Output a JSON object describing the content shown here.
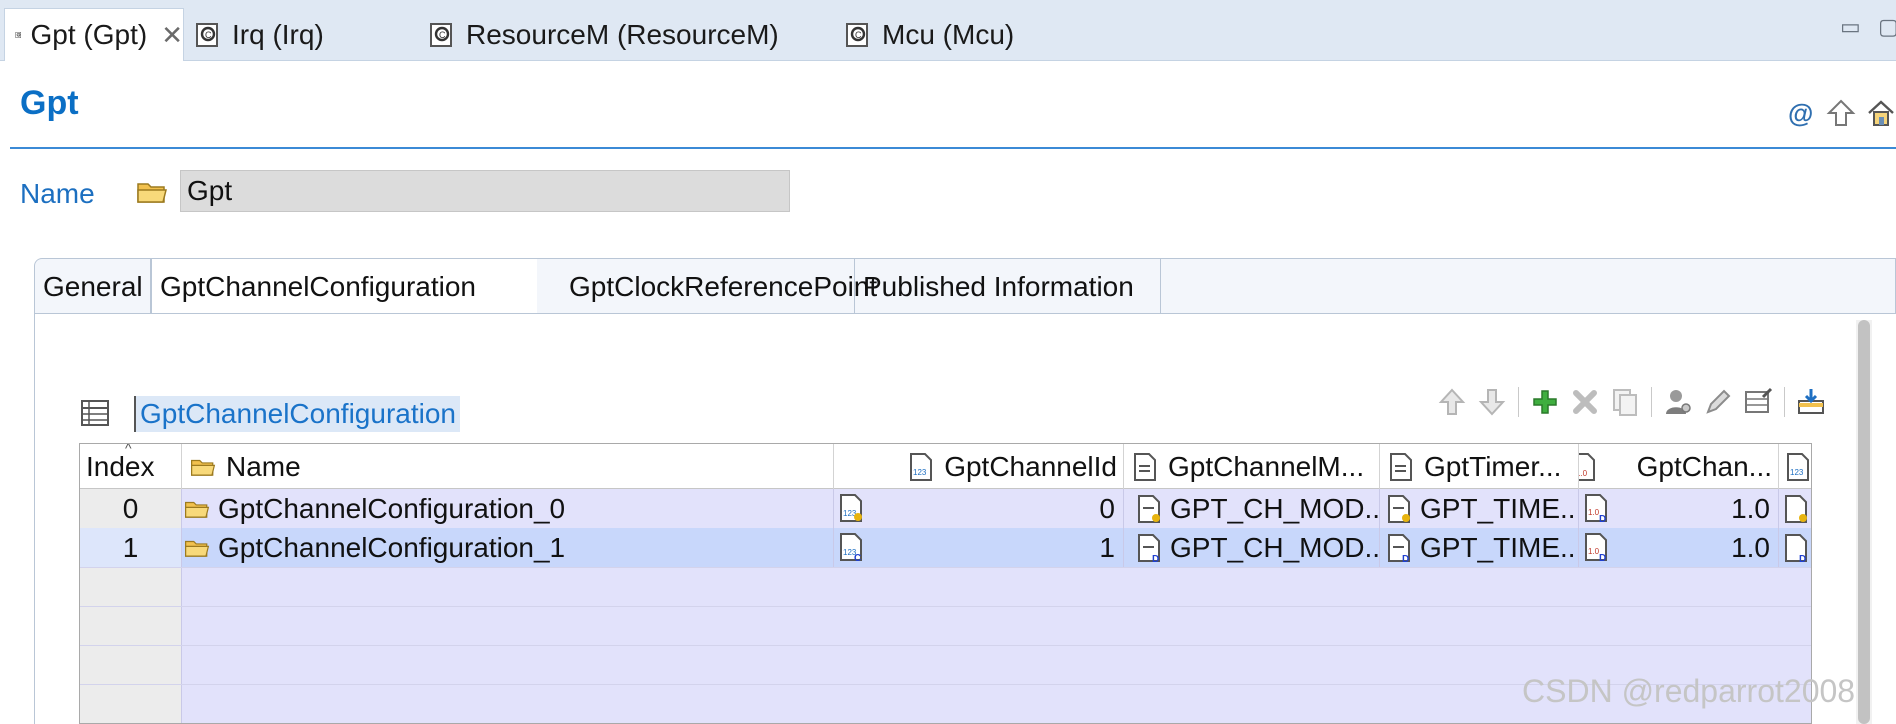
{
  "editor_tabs": [
    {
      "label": "Gpt (Gpt)",
      "active": true,
      "closable": true
    },
    {
      "label": "Irq (Irq)",
      "active": false
    },
    {
      "label": "ResourceM (ResourceM)",
      "active": false
    },
    {
      "label": "Mcu (Mcu)",
      "active": false
    }
  ],
  "form": {
    "title": "Gpt",
    "name_label": "Name",
    "name_value": "Gpt"
  },
  "page_tabs": [
    "General",
    "GptChannelConfiguration",
    "GptClockReferencePoint",
    "Published Information"
  ],
  "active_page_tab": "GptChannelConfiguration",
  "section": {
    "title": "GptChannelConfiguration",
    "toolbar_icons": [
      "move-up-icon",
      "move-down-icon",
      "add-icon",
      "delete-icon",
      "copy-icon",
      "user-settings-icon",
      "edit-icon",
      "table-edit-icon",
      "import-icon"
    ]
  },
  "table": {
    "columns": [
      "Index",
      "Name",
      "GptChannelId",
      "GptChannelM...",
      "GptTimer...",
      "GptChan..."
    ],
    "rows": [
      {
        "index": "0",
        "name": "GptChannelConfiguration_0",
        "channel_id": "0",
        "channel_mode": "GPT_CH_MOD...",
        "timer": "GPT_TIME...",
        "chan": "1.0"
      },
      {
        "index": "1",
        "name": "GptChannelConfiguration_1",
        "channel_id": "1",
        "channel_mode": "GPT_CH_MOD...",
        "timer": "GPT_TIME...",
        "chan": "1.0"
      }
    ]
  },
  "watermark": "CSDN @redparrot2008",
  "colors": {
    "accent": "#0b6fc5",
    "row_fill": "#e2e2fb",
    "row_selected": "#c8d7fb"
  }
}
